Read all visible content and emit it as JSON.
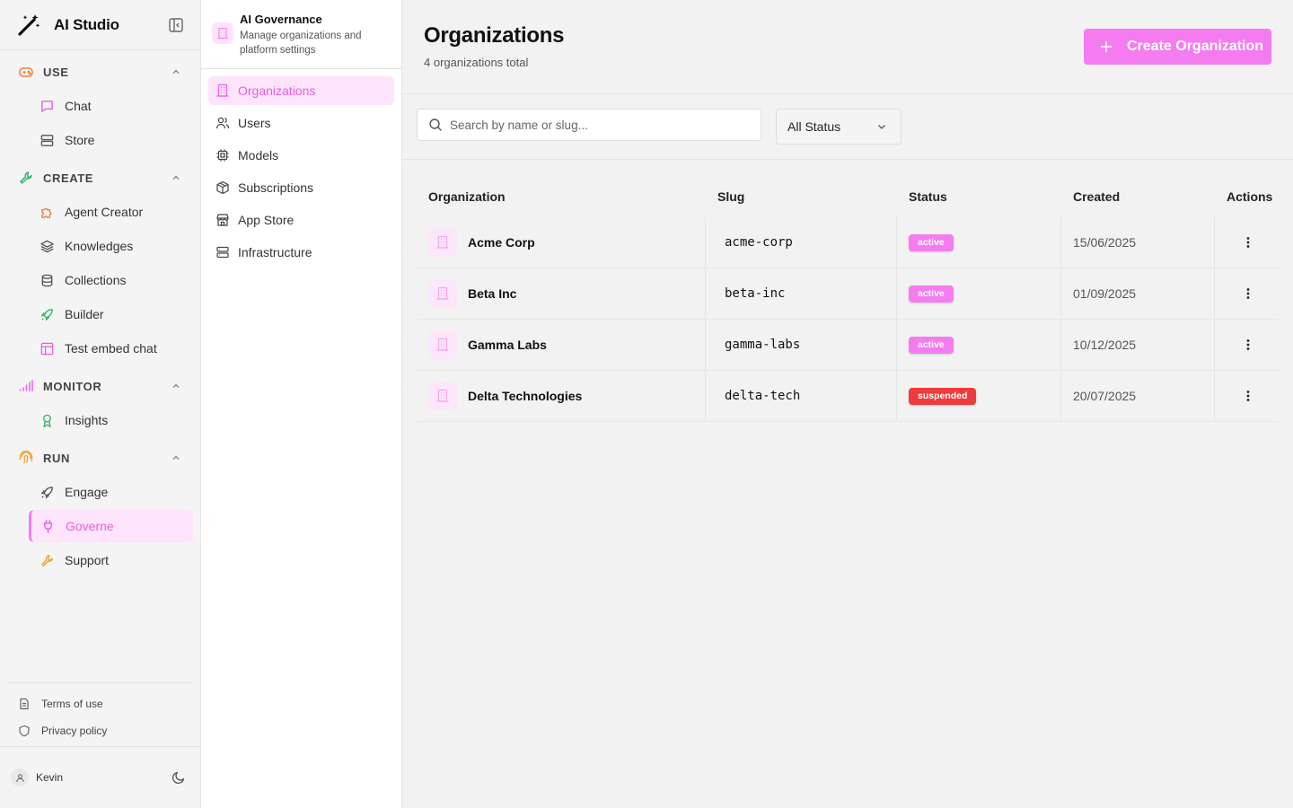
{
  "app": {
    "title": "AI Studio"
  },
  "sidebar": {
    "sections": [
      {
        "title": "USE",
        "items": [
          {
            "label": "Chat"
          },
          {
            "label": "Store"
          }
        ]
      },
      {
        "title": "CREATE",
        "items": [
          {
            "label": "Agent Creator"
          },
          {
            "label": "Knowledges"
          },
          {
            "label": "Collections"
          },
          {
            "label": "Builder"
          },
          {
            "label": "Test embed chat"
          }
        ]
      },
      {
        "title": "MONITOR",
        "items": [
          {
            "label": "Insights"
          }
        ]
      },
      {
        "title": "RUN",
        "items": [
          {
            "label": "Engage"
          },
          {
            "label": "Governe"
          },
          {
            "label": "Support"
          }
        ]
      }
    ],
    "active_item": "Governe",
    "footer_links": [
      {
        "label": "Terms of use"
      },
      {
        "label": "Privacy policy"
      }
    ],
    "user": {
      "name": "Kevin"
    }
  },
  "subnav": {
    "title": "AI Governance",
    "subtitle": "Manage organizations and platform settings",
    "items": [
      {
        "label": "Organizations",
        "icon": "building-icon"
      },
      {
        "label": "Users",
        "icon": "users-icon"
      },
      {
        "label": "Models",
        "icon": "cpu-icon"
      },
      {
        "label": "Subscriptions",
        "icon": "package-icon"
      },
      {
        "label": "App Store",
        "icon": "store-icon"
      },
      {
        "label": "Infrastructure",
        "icon": "server-icon"
      }
    ],
    "active_item": "Organizations"
  },
  "main": {
    "title": "Organizations",
    "subtitle": "4 organizations total",
    "create_button": "Create Organization",
    "search_placeholder": "Search by name or slug...",
    "status_filter": "All Status",
    "table": {
      "columns": [
        "Organization",
        "Slug",
        "Status",
        "Created",
        "Actions"
      ],
      "rows": [
        {
          "name": "Acme Corp",
          "slug": "acme-corp",
          "status": "active",
          "created": "15/06/2025"
        },
        {
          "name": "Beta Inc",
          "slug": "beta-inc",
          "status": "active",
          "created": "01/09/2025"
        },
        {
          "name": "Gamma Labs",
          "slug": "gamma-labs",
          "status": "active",
          "created": "10/12/2025"
        },
        {
          "name": "Delta Technologies",
          "slug": "delta-tech",
          "status": "suspended",
          "created": "20/07/2025"
        }
      ]
    }
  },
  "colors": {
    "accent": "#f47cf0",
    "accent_bg": "#fde4fb",
    "active_badge": "#f47cf0",
    "suspended_badge": "#ef3b3b"
  }
}
